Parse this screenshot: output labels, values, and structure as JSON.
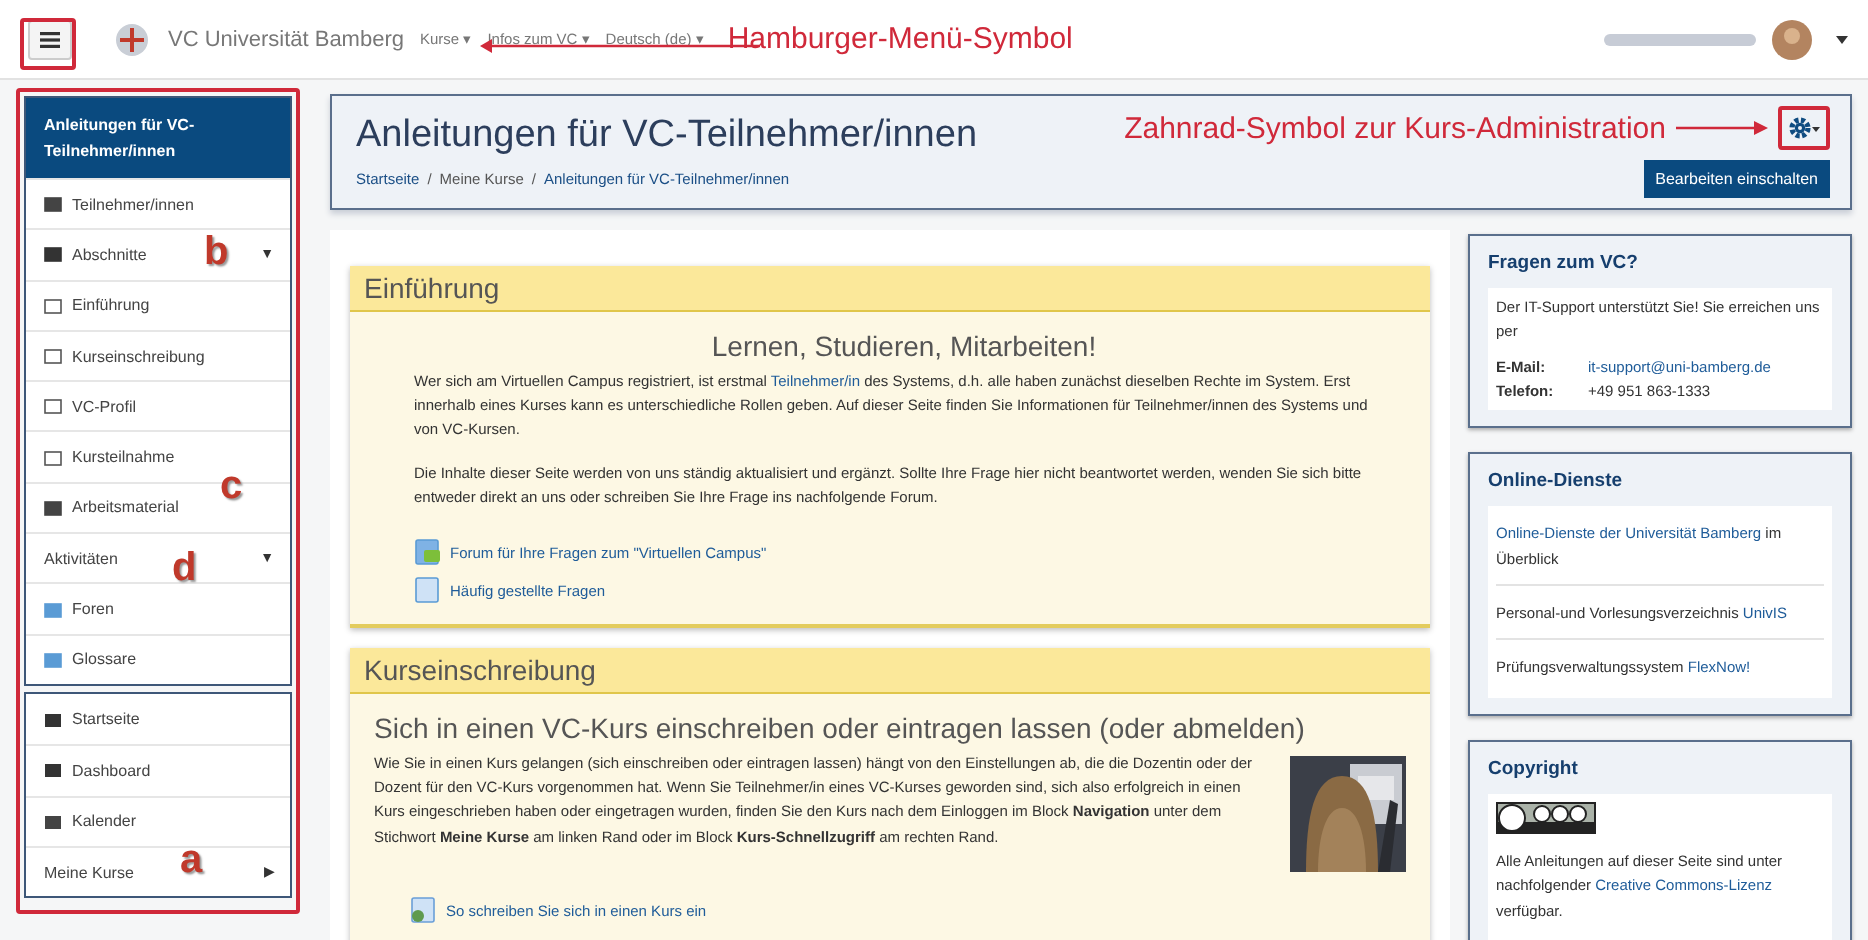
{
  "navbar": {
    "site_name": "VC Universität Bamberg",
    "menus": [
      "Kurse ▾",
      "Infos zum VC ▾",
      "Deutsch (de) ▾"
    ]
  },
  "annotations": {
    "hamburger": "Hamburger-Menü-Symbol",
    "gear": "Zahnrad-Symbol zur Kurs-Administration",
    "letters": [
      "b",
      "c",
      "d",
      "a"
    ]
  },
  "sidebar": {
    "course_title": "Anleitungen für VC-Teilnehmer/innen",
    "items": [
      {
        "label": "Teilnehmer/innen"
      },
      {
        "label": "Abschnitte",
        "caret": "▼"
      },
      {
        "label": "Einführung"
      },
      {
        "label": "Kurseinschreibung"
      },
      {
        "label": "VC-Profil"
      },
      {
        "label": "Kursteilnahme"
      },
      {
        "label": "Arbeitsmaterial"
      },
      {
        "label": "Aktivitäten",
        "caret": "▼"
      },
      {
        "label": "Foren"
      },
      {
        "label": "Glossare"
      }
    ],
    "site_items": [
      {
        "label": "Startseite"
      },
      {
        "label": "Dashboard"
      },
      {
        "label": "Kalender"
      },
      {
        "label": "Meine Kurse",
        "caret": "▶"
      }
    ]
  },
  "header": {
    "title": "Anleitungen für VC-Teilnehmer/innen",
    "separator": "/",
    "breadcrumb": [
      "Startseite",
      "Meine Kurse",
      "Anleitungen für VC-Teilnehmer/innen"
    ],
    "edit_button": "Bearbeiten einschalten"
  },
  "sections": [
    {
      "title": "Einführung",
      "heading": "Lernen, Studieren, Mitarbeiten!",
      "centered": true,
      "paragraphs": [
        [
          {
            "kind": "text",
            "text": "Wer sich am Virtuellen Campus registriert, ist erstmal "
          },
          {
            "kind": "link",
            "text": "Teilnehmer/in"
          },
          {
            "kind": "text",
            "text": " des Systems, d.h. alle haben zunächst dieselben Rechte im System. Erst innerhalb eines Kurses kann es unterschiedliche Rollen geben. Auf dieser Seite finden Sie Informationen für Teilnehmer/innen des Systems und von VC-Kursen."
          }
        ],
        [
          {
            "kind": "text",
            "text": "Die Inhalte dieser Seite werden von uns ständig aktualisiert und ergänzt. Sollte Ihre Frage hier nicht beantwortet werden, wenden Sie sich bitte entweder direkt an uns oder schreiben Sie Ihre Frage ins nachfolgende Forum."
          }
        ]
      ],
      "links": [
        {
          "text": "Forum für Ihre Fragen zum \"Virtuellen Campus\""
        },
        {
          "text": "Häufig gestellte Fragen"
        }
      ]
    },
    {
      "title": "Kurseinschreibung",
      "heading": "Sich in einen VC-Kurs einschreiben oder eintragen lassen (oder abmelden)",
      "centered": false,
      "picture": {
        "kind": "picture"
      },
      "paragraphs": [
        [
          {
            "kind": "text",
            "text": "Wie Sie in einen Kurs gelangen (sich einschreiben oder eintragen lassen) hängt von den Einstellungen ab, die die Dozentin oder der Dozent für den VC-Kurs vorgenommen hat. Wenn Sie Teilnehmer/in eines VC-Kurses geworden sind, sich also erfolgreich in einen Kurs eingeschrieben haben oder eingetragen wurden, finden Sie den Kurs nach dem Einloggen im Block **Navigation** unter dem Stichwort **Meine Kurse** am linken Rand oder im Block **Kurs-Schnellzugriff** am rechten Rand."
          }
        ]
      ],
      "links": [
        {
          "text": "So schreiben Sie sich in einen Kurs ein"
        }
      ]
    }
  ],
  "blocks": [
    {
      "title": "Fragen zum VC?",
      "intro": "Der IT-Support unterstützt Sie! Sie erreichen uns per",
      "contacts": [
        {
          "label": "E-Mail:",
          "value": "it-support@uni-bamberg.de",
          "kind": "link"
        },
        {
          "label": "Telefon:",
          "value": "+49 951 863-1333",
          "kind": "text"
        }
      ]
    },
    {
      "title": "Online-Dienste",
      "rows": [
        [
          {
            "kind": "link",
            "text": "Online-Dienste der Universität Bamberg"
          },
          {
            "kind": "text",
            "text": " im Überblick"
          }
        ],
        [
          {
            "kind": "text",
            "text": "Personal-und Vorlesungsverzeichnis "
          },
          {
            "kind": "link",
            "text": "UnivIS"
          }
        ],
        [
          {
            "kind": "text",
            "text": "Prüfungsverwaltungssystem "
          },
          {
            "kind": "link",
            "text": "FlexNow!"
          }
        ]
      ]
    },
    {
      "title": "Copyright",
      "license_badge": true,
      "rows": [
        [
          {
            "kind": "text",
            "text": "Alle Anleitungen auf dieser Seite sind unter nachfolgender "
          },
          {
            "kind": "link",
            "text": "Creative Commons-Lizenz"
          },
          {
            "kind": "text",
            "text": " verfügbar."
          }
        ]
      ]
    }
  ]
}
